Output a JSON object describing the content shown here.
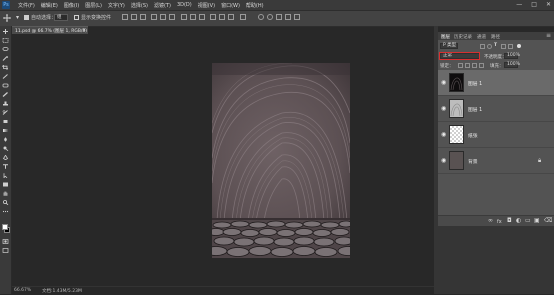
{
  "app": {
    "logo_text": "Ps"
  },
  "menu": {
    "items": [
      "文件(F)",
      "编辑(E)",
      "图像(I)",
      "图层(L)",
      "文字(Y)",
      "选择(S)",
      "滤镜(T)",
      "3D(D)",
      "视图(V)",
      "窗口(W)",
      "帮助(H)"
    ],
    "minimize": "—",
    "maximize": "□",
    "close": "✕"
  },
  "options_bar": {
    "auto_select_label": "自动选择：",
    "auto_select_value": "组",
    "show_transform_label": "显示变换控件"
  },
  "document": {
    "tab_title": "11.psd @ 66.7% (图层 1, RGB/8)",
    "tab_close": "×"
  },
  "status_bar": {
    "zoom": "66.67%",
    "doc_info": "文档:1.43M/5.23M"
  },
  "layers_panel": {
    "tabs": [
      "图层",
      "历史记录",
      "通道",
      "路径"
    ],
    "active_tab": 0,
    "kind_filter": "P 类型",
    "blend_mode": "正常",
    "opacity_label": "不透明度：",
    "opacity_value": "100%",
    "lock_label": "锁定：",
    "fill_label": "填充：",
    "fill_value": "100%",
    "layers": [
      {
        "name": "图层 1",
        "visible": true,
        "selected": true,
        "thumb": "dark-texture"
      },
      {
        "name": "图层 1",
        "visible": true,
        "selected": false,
        "thumb": "light-texture"
      },
      {
        "name": "纸张",
        "visible": true,
        "selected": false,
        "thumb": "transparent"
      },
      {
        "name": "背景",
        "visible": true,
        "selected": false,
        "thumb": "gray",
        "locked": true
      }
    ],
    "footer_icons": [
      "link-icon",
      "fx-icon",
      "mask-icon",
      "adjustment-icon",
      "folder-icon",
      "new-layer-icon",
      "trash-icon"
    ]
  },
  "colors": {
    "menubar": "#3a3a3a",
    "canvas_bg": "#282828",
    "panel_bg": "#535353",
    "selected_layer": "#6a6a6a",
    "highlight_red": "#d83030"
  }
}
